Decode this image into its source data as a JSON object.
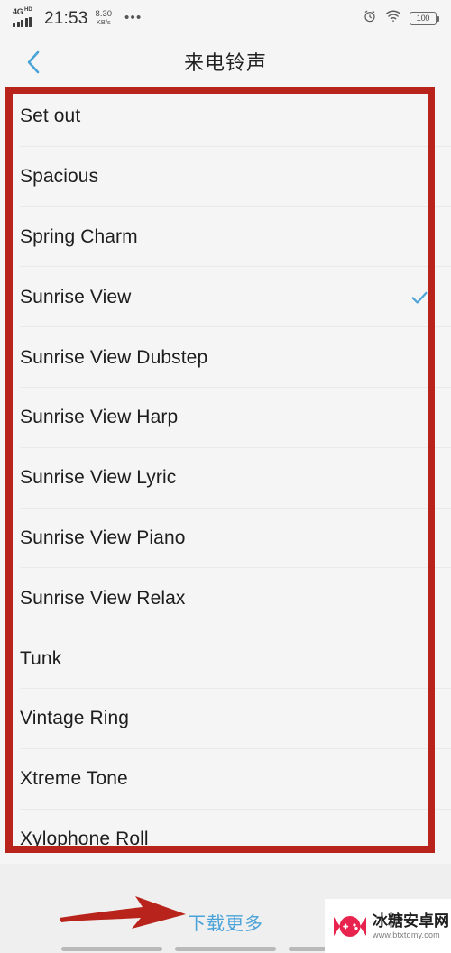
{
  "statusbar": {
    "network_type": "4G",
    "network_suffix": "HD",
    "time": "21:53",
    "speed_value": "8.30",
    "speed_unit": "KB/s",
    "overflow_dots": "•••",
    "alarm_icon": "alarm-clock-icon",
    "wifi_icon": "wifi-icon",
    "battery_level": "100"
  },
  "header": {
    "back_icon": "chevron-left-icon",
    "title": "来电铃声"
  },
  "list": {
    "items": [
      {
        "label": "Set out",
        "selected": false
      },
      {
        "label": "Spacious",
        "selected": false
      },
      {
        "label": "Spring Charm",
        "selected": false
      },
      {
        "label": "Sunrise View",
        "selected": true
      },
      {
        "label": "Sunrise View Dubstep",
        "selected": false
      },
      {
        "label": "Sunrise View Harp",
        "selected": false
      },
      {
        "label": "Sunrise View Lyric",
        "selected": false
      },
      {
        "label": "Sunrise View Piano",
        "selected": false
      },
      {
        "label": "Sunrise View Relax",
        "selected": false
      },
      {
        "label": "Tunk",
        "selected": false
      },
      {
        "label": "Vintage Ring",
        "selected": false
      },
      {
        "label": "Xtreme Tone",
        "selected": false
      },
      {
        "label": "Xylophone Roll",
        "selected": false
      }
    ],
    "check_icon": "check-icon",
    "check_color": "#4ba3d8"
  },
  "footer": {
    "download_more_label": "下载更多",
    "download_more_color": "#4ba3d8"
  },
  "annotations": {
    "box_color": "#b8241b",
    "arrow_color": "#b8241b",
    "arrow_icon": "right-arrow-annotation"
  },
  "watermark": {
    "site_name": "冰糖安卓网",
    "site_url": "www.btxtdmy.com",
    "logo_icon": "game-controller-candy-logo",
    "logo_color": "#e8244e"
  }
}
